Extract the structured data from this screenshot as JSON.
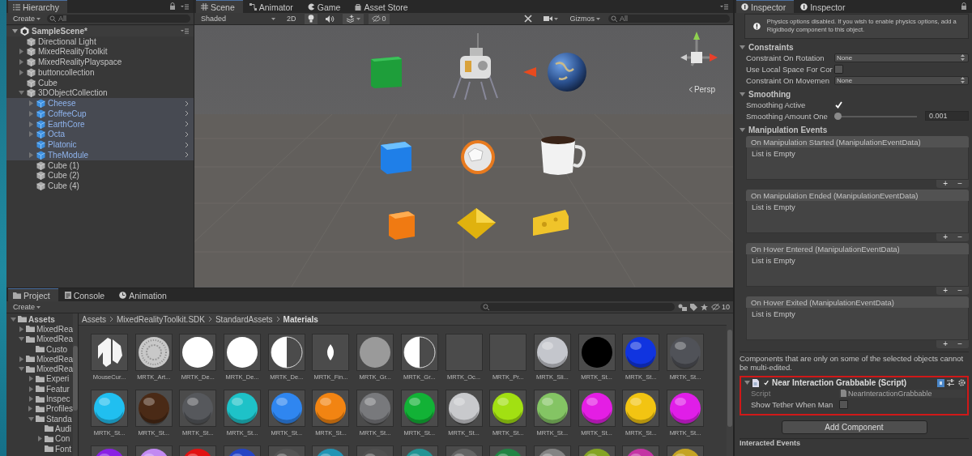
{
  "hierarchy": {
    "tab": "Hierarchy",
    "create": "Create",
    "search_placeholder": "All",
    "scene": {
      "label": "SampleScene*",
      "expanded": true
    },
    "items": [
      {
        "label": "Directional Light",
        "kind": "object",
        "selected": false
      },
      {
        "label": "MixedRealityToolkit",
        "kind": "object",
        "selected": false,
        "expanded": false
      },
      {
        "label": "MixedRealityPlayspace",
        "kind": "object",
        "selected": false,
        "expanded": false
      },
      {
        "label": "buttoncollection",
        "kind": "object",
        "selected": false,
        "expanded": false
      },
      {
        "label": "Cube",
        "kind": "object",
        "selected": false
      },
      {
        "label": "3DObjectCollection",
        "kind": "object",
        "selected": false,
        "expanded": true,
        "children": [
          {
            "label": "Cheese",
            "kind": "prefab",
            "selected": true,
            "expanded": false
          },
          {
            "label": "CoffeeCup",
            "kind": "prefab",
            "selected": true,
            "expanded": false
          },
          {
            "label": "EarthCore",
            "kind": "prefab",
            "selected": true,
            "expanded": false
          },
          {
            "label": "Octa",
            "kind": "prefab",
            "selected": true,
            "expanded": false
          },
          {
            "label": "Platonic",
            "kind": "prefab",
            "selected": true
          },
          {
            "label": "TheModule",
            "kind": "prefab",
            "selected": true,
            "expanded": false
          },
          {
            "label": "Cube (1)",
            "kind": "object",
            "selected": false
          },
          {
            "label": "Cube (2)",
            "kind": "object",
            "selected": false
          },
          {
            "label": "Cube (4)",
            "kind": "object",
            "selected": false
          }
        ]
      }
    ]
  },
  "scene_view": {
    "tabs": [
      {
        "label": "Scene",
        "kind": "scene",
        "selected": true
      },
      {
        "label": "Animator",
        "kind": "animator",
        "selected": false
      },
      {
        "label": "Game",
        "kind": "game",
        "selected": false
      },
      {
        "label": "Asset Store",
        "kind": "store",
        "selected": false
      }
    ],
    "shading": "Shaded",
    "mode_2d": "2D",
    "lighting_on": true,
    "audio_on": false,
    "effects_on": true,
    "hidden_count": "0",
    "gizmos": "Gizmos",
    "search_placeholder": "All",
    "projection": "Persp"
  },
  "inspector": {
    "tabs": [
      {
        "label": "Inspector",
        "selected": true
      },
      {
        "label": "Inspector",
        "selected": false
      }
    ],
    "help": "Physics options disabled. If you wish to enable physics options, add a Rigidbody component to this object.",
    "sections": [
      {
        "title": "Constraints",
        "expanded": true,
        "rows": [
          {
            "kind": "dropdown",
            "label": "Constraint On Rotation",
            "value": "None"
          },
          {
            "kind": "checkbox",
            "label": "Use Local Space For Cor",
            "checked": false
          },
          {
            "kind": "dropdown",
            "label": "Constraint On Movemen",
            "value": "None"
          }
        ]
      },
      {
        "title": "Smoothing",
        "expanded": true,
        "rows": [
          {
            "kind": "checkbox",
            "label": "Smoothing Active",
            "checked": true
          },
          {
            "kind": "slider",
            "label": "Smoothing Amount One",
            "level": 0,
            "value": "0.001"
          }
        ]
      },
      {
        "title": "Manipulation Events",
        "expanded": true
      }
    ],
    "events": [
      {
        "title": "On Manipulation Started (ManipulationEventData)",
        "empty": "List is Empty",
        "add": "+",
        "remove": "−"
      },
      {
        "title": "On Manipulation Ended (ManipulationEventData)",
        "empty": "List is Empty",
        "add": "+",
        "remove": "−"
      },
      {
        "title": "On Hover Entered (ManipulationEventData)",
        "empty": "List is Empty",
        "add": "+",
        "remove": "−"
      },
      {
        "title": "On Hover Exited (ManipulationEventData)",
        "empty": "List is Empty",
        "add": "+",
        "remove": "−"
      }
    ],
    "note": "Components that are only on some of the selected objects cannot be multi-edited.",
    "component": {
      "title": "Near Interaction Grabbable (Script)",
      "enabled": true,
      "expanded": true,
      "highlighted": true,
      "fields": [
        {
          "kind": "object",
          "label": "Script",
          "value": "NearInteractionGrabbable"
        },
        {
          "kind": "checkbox",
          "label": "Show Tether When Man",
          "checked": false
        }
      ]
    },
    "add_component": "Add Component",
    "next_section": "Interacted Events"
  },
  "project": {
    "tabs": [
      {
        "label": "Project",
        "kind": "folder",
        "selected": true
      },
      {
        "label": "Console",
        "kind": "console",
        "selected": false
      },
      {
        "label": "Animation",
        "kind": "clock",
        "selected": false
      }
    ],
    "create": "Create",
    "zoom_label": "10",
    "folders": [
      {
        "label": "Assets",
        "expanded": true,
        "children": [
          {
            "label": "MixedRea",
            "expanded": false
          },
          {
            "label": "MixedRea",
            "expanded": true,
            "children": [
              {
                "label": "Custo"
              }
            ]
          },
          {
            "label": "MixedRea",
            "expanded": false
          },
          {
            "label": "MixedRea",
            "expanded": true,
            "children": [
              {
                "label": "Experi",
                "expanded": false
              },
              {
                "label": "Featur",
                "expanded": false
              },
              {
                "label": "Inspec",
                "expanded": false
              },
              {
                "label": "Profiles",
                "expanded": false
              },
              {
                "label": "Standa",
                "expanded": true,
                "children": [
                  {
                    "label": "Audi"
                  },
                  {
                    "label": "Con",
                    "expanded": false
                  },
                  {
                    "label": "Font"
                  }
                ]
              }
            ]
          }
        ]
      }
    ],
    "breadcrumb": [
      "Assets",
      "MixedRealityToolkit.SDK",
      "StandardAssets",
      "Materials"
    ],
    "materials": [
      {
        "label": "MouseCur...",
        "kind": "logo"
      },
      {
        "label": "MRTK_Art...",
        "kind": "noise"
      },
      {
        "label": "MRTK_De...",
        "kind": "disc",
        "color": "#ffffff"
      },
      {
        "label": "MRTK_De...",
        "kind": "disc",
        "color": "#ffffff"
      },
      {
        "label": "MRTK_De...",
        "kind": "half"
      },
      {
        "label": "MRTK_Fin...",
        "kind": "leaf"
      },
      {
        "label": "MRTK_Gr...",
        "kind": "disc",
        "color": "#9a9a9a"
      },
      {
        "label": "MRTK_Gr...",
        "kind": "half"
      },
      {
        "label": "MRTK_Oc...",
        "kind": "flat"
      },
      {
        "label": "MRTK_Pr...",
        "kind": "flat"
      },
      {
        "label": "MRTK_Sli...",
        "kind": "sphere",
        "color": "#c4c6cc"
      },
      {
        "label": "MRTK_St...",
        "kind": "disc",
        "color": "#000000"
      },
      {
        "label": "MRTK_St...",
        "kind": "sphere",
        "color": "#1034e0"
      },
      {
        "label": "MRTK_St...",
        "kind": "sphere",
        "color": "#505258"
      },
      {
        "label": "MRTK_St...",
        "kind": "sphere",
        "color": "#20bff0"
      },
      {
        "label": "MRTK_St...",
        "kind": "sphere",
        "color": "#4a2a16"
      },
      {
        "label": "MRTK_St...",
        "kind": "sphere",
        "color": "#56585c"
      },
      {
        "label": "MRTK_St...",
        "kind": "sphere",
        "color": "#1ec2c8"
      },
      {
        "label": "MRTK_St...",
        "kind": "sphere",
        "color": "#2f86f0"
      },
      {
        "label": "MRTK_St...",
        "kind": "sphere",
        "color": "#f28412"
      },
      {
        "label": "MRTK_St...",
        "kind": "sphere",
        "color": "#78797c"
      },
      {
        "label": "MRTK_St...",
        "kind": "sphere",
        "color": "#12b236"
      },
      {
        "label": "MRTK_St...",
        "kind": "sphere",
        "color": "#c8c9cc"
      },
      {
        "label": "MRTK_St...",
        "kind": "sphere",
        "color": "#a2e012"
      },
      {
        "label": "MRTK_St...",
        "kind": "sphere",
        "color": "#84c464"
      },
      {
        "label": "MRTK_St...",
        "kind": "sphere",
        "color": "#e41ee4"
      },
      {
        "label": "MRTK_St...",
        "kind": "sphere",
        "color": "#f2c412"
      },
      {
        "label": "MRTK_St...",
        "kind": "sphere",
        "color": "#e01ee8"
      },
      {
        "kind": "sphere",
        "color": "#8a22e4"
      },
      {
        "kind": "sphere",
        "color": "#c28af2"
      },
      {
        "kind": "sphere",
        "color": "#e21212"
      },
      {
        "kind": "sphere",
        "color": "#2444c4"
      },
      {
        "kind": "sphere",
        "color": "#545454"
      },
      {
        "kind": "sphere",
        "color": "#2294b4"
      },
      {
        "kind": "sphere",
        "color": "#505050"
      },
      {
        "kind": "sphere",
        "color": "#229494"
      },
      {
        "kind": "sphere",
        "color": "#646464"
      },
      {
        "kind": "sphere",
        "color": "#228444"
      },
      {
        "kind": "sphere",
        "color": "#848484"
      },
      {
        "kind": "sphere",
        "color": "#84a424"
      },
      {
        "kind": "sphere",
        "color": "#c434a4"
      },
      {
        "kind": "sphere",
        "color": "#c4a424"
      }
    ]
  }
}
